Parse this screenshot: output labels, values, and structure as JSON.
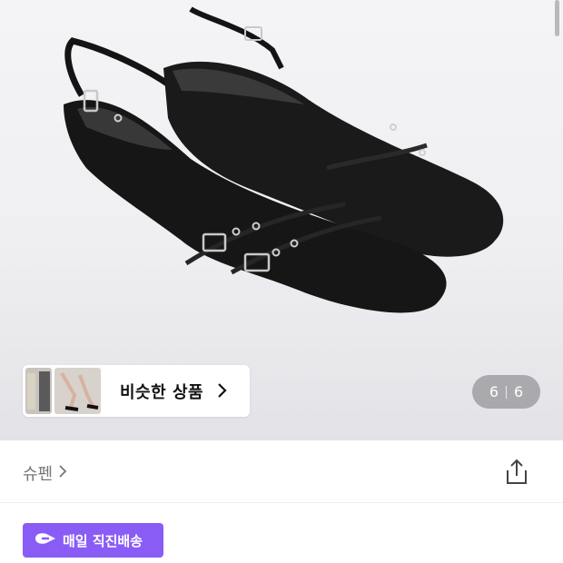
{
  "product_image": {
    "subject": "black slingback kitten-heel pumps"
  },
  "similar_products": {
    "label": "비슷한 상품",
    "icon": "chevron-right-icon"
  },
  "image_counter": {
    "current": "6",
    "total": "6"
  },
  "brand": {
    "name": "슈펜",
    "icon": "chevron-right-icon"
  },
  "share": {
    "icon": "share-icon"
  },
  "delivery_badge": {
    "label": "매일 직진배송",
    "icon": "delivery-arrow-icon",
    "color": "#8a5cf6"
  }
}
